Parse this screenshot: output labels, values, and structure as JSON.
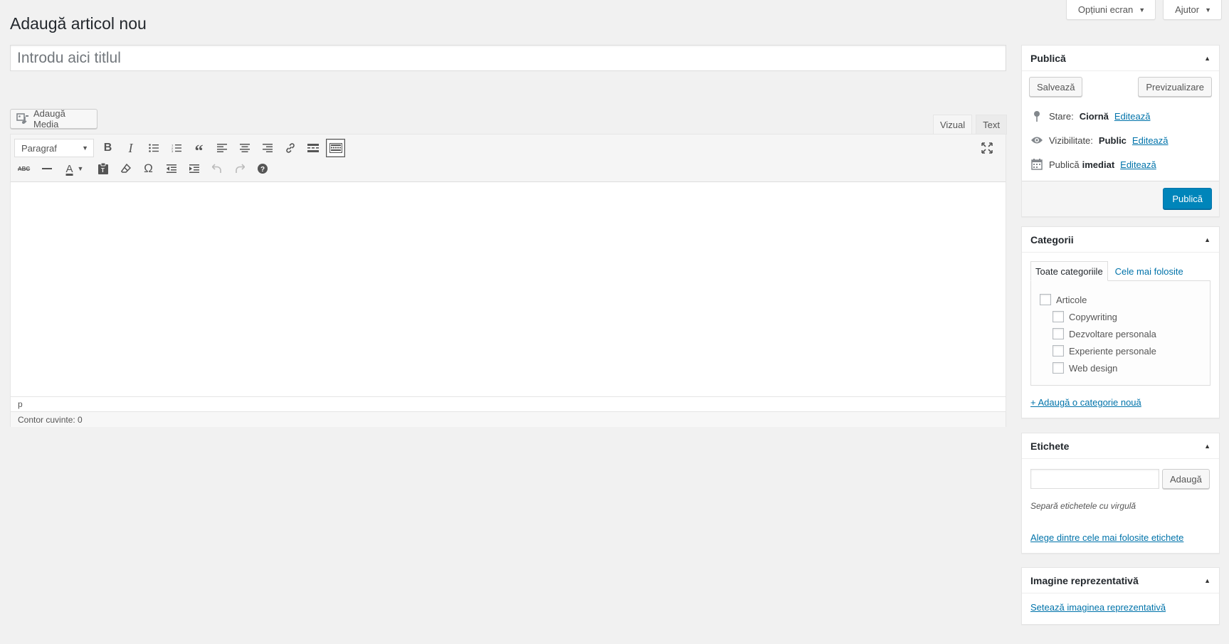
{
  "screen_meta": {
    "screen_options": "Opțiuni ecran",
    "help": "Ajutor"
  },
  "page": {
    "title": "Adaugă articol nou",
    "title_placeholder": "Introdu aici titlul"
  },
  "editor": {
    "add_media": "Adaugă Media",
    "tabs": {
      "visual": "Vizual",
      "text": "Text",
      "active": "visual"
    },
    "format_select": "Paragraf",
    "path": "p",
    "word_count": "Contor cuvinte: 0",
    "toolbar_row1_icons": [
      "bold-icon",
      "italic-icon",
      "bullet-list-icon",
      "numbered-list-icon",
      "blockquote-icon",
      "align-left-icon",
      "align-center-icon",
      "align-right-icon",
      "link-icon",
      "read-more-icon",
      "toolbar-toggle-icon"
    ],
    "toolbar_row2_icons": [
      "strikethrough-icon",
      "horizontal-line-icon",
      "text-color-icon",
      "paste-text-icon",
      "clear-formatting-icon",
      "special-character-icon",
      "outdent-icon",
      "indent-icon",
      "undo-icon",
      "redo-icon",
      "help-icon"
    ]
  },
  "publish": {
    "title": "Publică",
    "save": "Salvează",
    "preview": "Previzualizare",
    "status_label": "Stare:",
    "status_value": "Ciornă",
    "visibility_label": "Vizibilitate:",
    "visibility_value": "Public",
    "schedule_label": "Publică",
    "schedule_value": "imediat",
    "edit": "Editează",
    "publish_button": "Publică",
    "accent": "#0085ba"
  },
  "categories": {
    "title": "Categorii",
    "tab_all": "Toate categoriile",
    "tab_popular": "Cele mai folosite",
    "items": [
      {
        "label": "Articole",
        "level": 0
      },
      {
        "label": "Copywriting",
        "level": 1
      },
      {
        "label": "Dezvoltare personala",
        "level": 1
      },
      {
        "label": "Experiente personale",
        "level": 1
      },
      {
        "label": "Web design",
        "level": 1
      }
    ],
    "add_new": "+ Adaugă o categorie nouă"
  },
  "tags": {
    "title": "Etichete",
    "add_button": "Adaugă",
    "hint": "Separă etichetele cu virgulă",
    "choose_link": "Alege dintre cele mai folosite etichete"
  },
  "featured_image": {
    "title": "Imagine reprezentativă",
    "set_link": "Setează imaginea reprezentativă"
  }
}
